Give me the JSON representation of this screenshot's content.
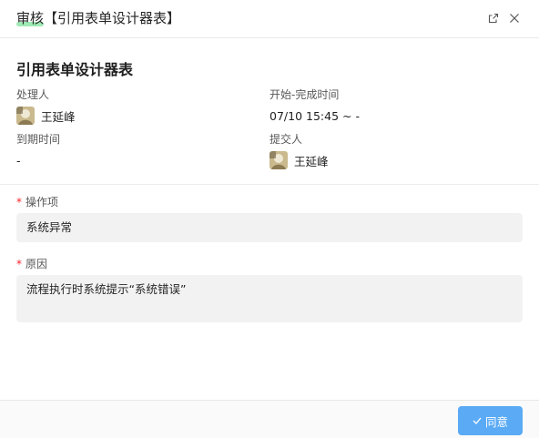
{
  "header": {
    "title_prefix": "审核",
    "title_rest": "【引用表单设计器表】",
    "open_icon": "external-link-icon",
    "close_icon": "close-icon"
  },
  "form": {
    "title": "引用表单设计器表",
    "info": {
      "handler_label": "处理人",
      "handler_name": "王延峰",
      "start_end_label": "开始-完成时间",
      "start_end_value": "07/10 15:45 ~ -",
      "due_label": "到期时间",
      "due_value": "-",
      "submitter_label": "提交人",
      "submitter_name": "王延峰"
    },
    "fields": [
      {
        "label": "操作项",
        "required": "*",
        "value": "系统异常"
      },
      {
        "label": "原因",
        "required": "*",
        "value": "流程执行时系统提示“系统错误”"
      }
    ]
  },
  "footer": {
    "agree_label": "同意",
    "agree_icon": "check-icon"
  },
  "colors": {
    "accent": "#5aaaf5",
    "title_highlight": "#8ee6a8",
    "required": "#f5222d"
  }
}
